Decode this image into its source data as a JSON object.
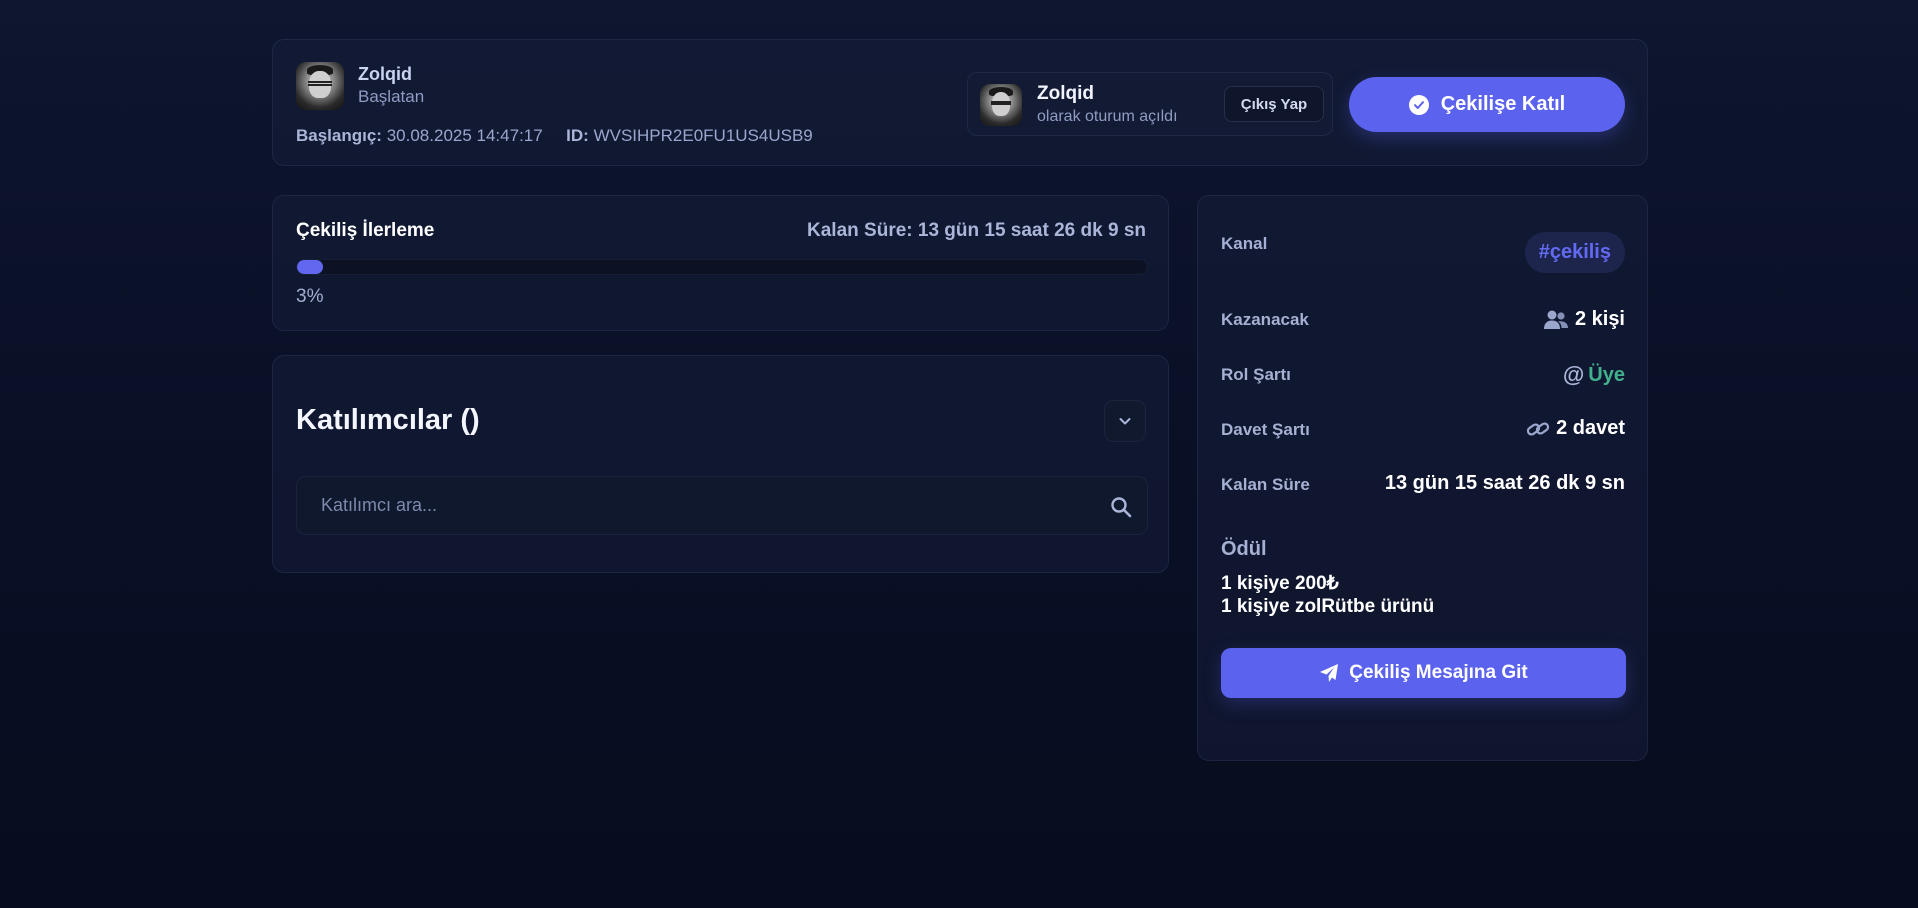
{
  "header": {
    "host_name": "Zolqid",
    "host_role": "Başlatan",
    "start_label": "Başlangıç:",
    "start_value": "30.08.2025 14:47:17",
    "id_label": "ID:",
    "id_value": "WVSIHPR2E0FU1US4USB9"
  },
  "session": {
    "user_name": "Zolqid",
    "status": "olarak oturum açıldı",
    "logout_label": "Çıkış Yap"
  },
  "join_button": {
    "label": "Çekilişe Katıl",
    "icon": "check-circle-icon"
  },
  "progress": {
    "title": "Çekiliş İlerleme",
    "remaining": "Kalan Süre: 13 gün 15 saat 26 dk 9 sn",
    "percent": 3,
    "percent_label": "3%"
  },
  "participants": {
    "title": "Katılımcılar ()",
    "search_placeholder": "Katılımcı ara...",
    "search_value": ""
  },
  "info": {
    "channel_label": "Kanal",
    "channel_value": "#çekiliş",
    "winners_label": "Kazanacak",
    "winners_value": "2 kişi",
    "role_label": "Rol Şartı",
    "role_at": "@",
    "role_value": "Üye",
    "invite_label": "Davet Şartı",
    "invite_value": "2 davet",
    "remaining_label": "Kalan Süre",
    "remaining_value": "13 gün 15 saat 26 dk 9 sn",
    "prize_label": "Ödül",
    "prize_lines": [
      "1 kişiye 200₺",
      "1 kişiye zolRütbe ürünü"
    ],
    "goto_label": "Çekiliş Mesajına Git"
  },
  "colors": {
    "accent": "#5b63ee",
    "role_green": "#41b08c",
    "background": "#0a1128"
  }
}
